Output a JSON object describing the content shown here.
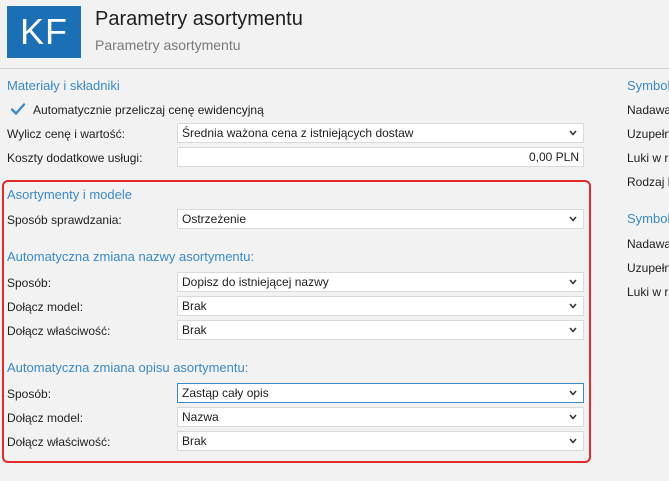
{
  "header": {
    "logo_text": "KF",
    "title": "Parametry asortymentu",
    "subtitle": "Parametry asortymentu"
  },
  "materials": {
    "section_title": "Materiały i składniki",
    "auto_recalc": {
      "label": "Automatycznie przeliczaj cenę ewidencyjną",
      "checked": true
    },
    "calc_price_label": "Wylicz cenę i wartość:",
    "calc_price_value": "Średnia ważona cena z istniejących dostaw",
    "extra_costs_label": "Koszty dodatkowe usługi:",
    "extra_costs_value": "0,00 PLN"
  },
  "assortments": {
    "section_title": "Asortymenty i modele",
    "check_method_label": "Sposób sprawdzania:",
    "check_method_value": "Ostrzeżenie"
  },
  "name_change": {
    "section_title": "Automatyczna zmiana nazwy asortymentu:",
    "method_label": "Sposób:",
    "method_value": "Dopisz do istniejącej nazwy",
    "attach_model_label": "Dołącz model:",
    "attach_model_value": "Brak",
    "attach_property_label": "Dołącz właściwość:",
    "attach_property_value": "Brak"
  },
  "desc_change": {
    "section_title": "Automatyczna zmiana opisu asortymentu:",
    "method_label": "Sposób:",
    "method_value": "Zastąp cały opis",
    "attach_model_label": "Dołącz model:",
    "attach_model_value": "Nazwa",
    "attach_property_label": "Dołącz właściwość:",
    "attach_property_value": "Brak"
  },
  "right": {
    "section1_title": "Symbol",
    "s1_rows": [
      "Nadawa",
      "Uzupełn",
      "Luki w r",
      "Rodzaj k"
    ],
    "section2_title": "Symbol",
    "s2_rows": [
      "Nadawa",
      "Uzupełn",
      "Luki w r"
    ]
  },
  "colors": {
    "accent": "#3a89c9",
    "logo_bg": "#1a6fb5",
    "highlight_border": "#e22b2b"
  }
}
